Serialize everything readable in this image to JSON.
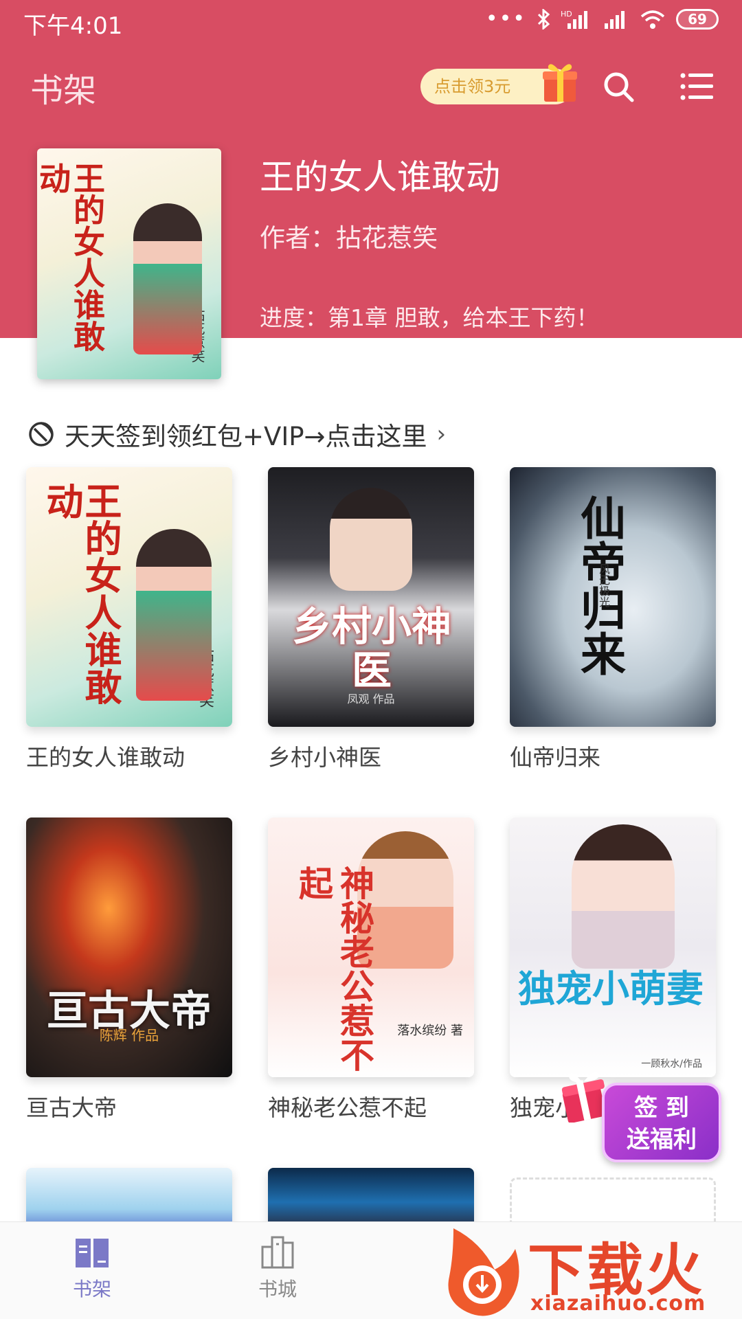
{
  "status_bar": {
    "time": "下午4:01",
    "battery": "69",
    "network_badge": "HD"
  },
  "header": {
    "title": "书架",
    "coupon": "点击领3元"
  },
  "featured": {
    "title": "王的女人谁敢动",
    "author": "作者：拈花惹笑",
    "progress": "进度：第1章 胆敢，给本王下药！",
    "cover_text": "王的女人谁敢动",
    "cover_author": "拈花惹笑"
  },
  "signin": {
    "text": "天天签到领红包+VIP→点击这里",
    "chevron": "›"
  },
  "books": [
    {
      "title": "王的女人谁敢动",
      "cover_text": "王的女人谁敢动",
      "cover_sub": "拈花惹笑"
    },
    {
      "title": "乡村小神医",
      "cover_text": "乡村小神医",
      "cover_sub": "凤观 作品"
    },
    {
      "title": "仙帝归来",
      "cover_text": "仙帝归来",
      "cover_sub": "风无极光"
    },
    {
      "title": "亘古大帝",
      "cover_text": "亘古大帝",
      "cover_sub": "陈辉 作品"
    },
    {
      "title": "神秘老公惹不起",
      "cover_text": "神秘老公惹不起",
      "cover_sub": "落水缤纷 著"
    },
    {
      "title": "独宠小萌妻",
      "cover_text": "独宠小萌妻",
      "cover_sub": "一顾秋水/作品"
    }
  ],
  "float_badge": {
    "line1": "签 到",
    "line2": "送福利"
  },
  "nav": [
    {
      "label": "书架",
      "active": true
    },
    {
      "label": "书城",
      "active": false
    }
  ],
  "watermark": {
    "text": "下载火",
    "sub": "xiazaihuo.com"
  },
  "colors": {
    "header": "#d84d63",
    "nav_active": "#7b79c7",
    "nav_inactive": "#888888"
  }
}
